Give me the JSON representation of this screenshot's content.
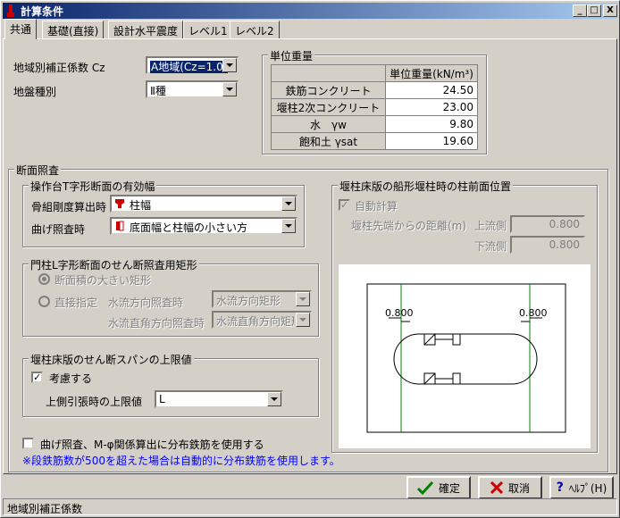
{
  "window": {
    "title": "計算条件",
    "min_label": "_",
    "max_label": "□",
    "close_label": "X"
  },
  "tabs": [
    "共通",
    "基礎(直接)",
    "設計水平震度",
    "レベル1",
    "レベル2"
  ],
  "region_coef": {
    "label": "地域別補正係数 Cz",
    "value": "A地域(Cz=1.0)"
  },
  "ground_type": {
    "label": "地盤種別",
    "value": "Ⅱ種"
  },
  "unit_weight": {
    "title": "単位重量",
    "header": "単位重量(kN/m³)",
    "rows": [
      {
        "name": "鉄筋コンクリート",
        "value": "24.50"
      },
      {
        "name": "堰柱2次コンクリート",
        "value": "23.00"
      },
      {
        "name": "水　γw",
        "value": "9.80"
      },
      {
        "name": "飽和土 γsat",
        "value": "19.60"
      }
    ]
  },
  "section_check": {
    "title": "断面照査",
    "t_section": {
      "title": "操作台T字形断面の有効幅",
      "stiffness_label": "骨組剛度算出時",
      "stiffness_value": "柱幅",
      "bending_label": "曲げ照査時",
      "bending_value": "底面幅と柱幅の小さい方"
    },
    "l_section": {
      "title": "門柱L字形断面のせん断照査用矩形",
      "option1": "断面積の大きい矩形",
      "option2": "直接指定",
      "flow_label": "水流方向照査時",
      "flow_value": "水流方向矩形",
      "perp_label": "水流直角方向照査時",
      "perp_value": "水流直角方向矩形"
    },
    "shear_span": {
      "title": "堰柱床版のせん断スパンの上限値",
      "consider_label": "考慮する",
      "limit_label": "上側引張時の上限値",
      "limit_value": "L"
    },
    "distribution_label": "曲げ照査、M-φ関係算出に分布鉄筋を使用する",
    "note": "※段鉄筋数が500を超えた場合は自動的に分布鉄筋を使用します。"
  },
  "pier_position": {
    "title": "堰柱床版の船形堰柱時の柱前面位置",
    "auto_label": "自動計算",
    "distance_label": "堰柱先端からの距離(m)",
    "upstream_label": "上流側",
    "upstream_value": "0.800",
    "downstream_label": "下流側",
    "downstream_value": "0.800",
    "diagram_left": "0.800",
    "diagram_right": "0.800"
  },
  "buttons": {
    "ok": "確定",
    "cancel": "取消",
    "help": "ﾍﾙﾌﾟ(H)"
  },
  "status": "地域別補正係数",
  "colors": {
    "titlebar": "#0a246a",
    "note_text": "#0000ff",
    "diagram_line": "#008000",
    "icon_red": "#cc0000"
  }
}
